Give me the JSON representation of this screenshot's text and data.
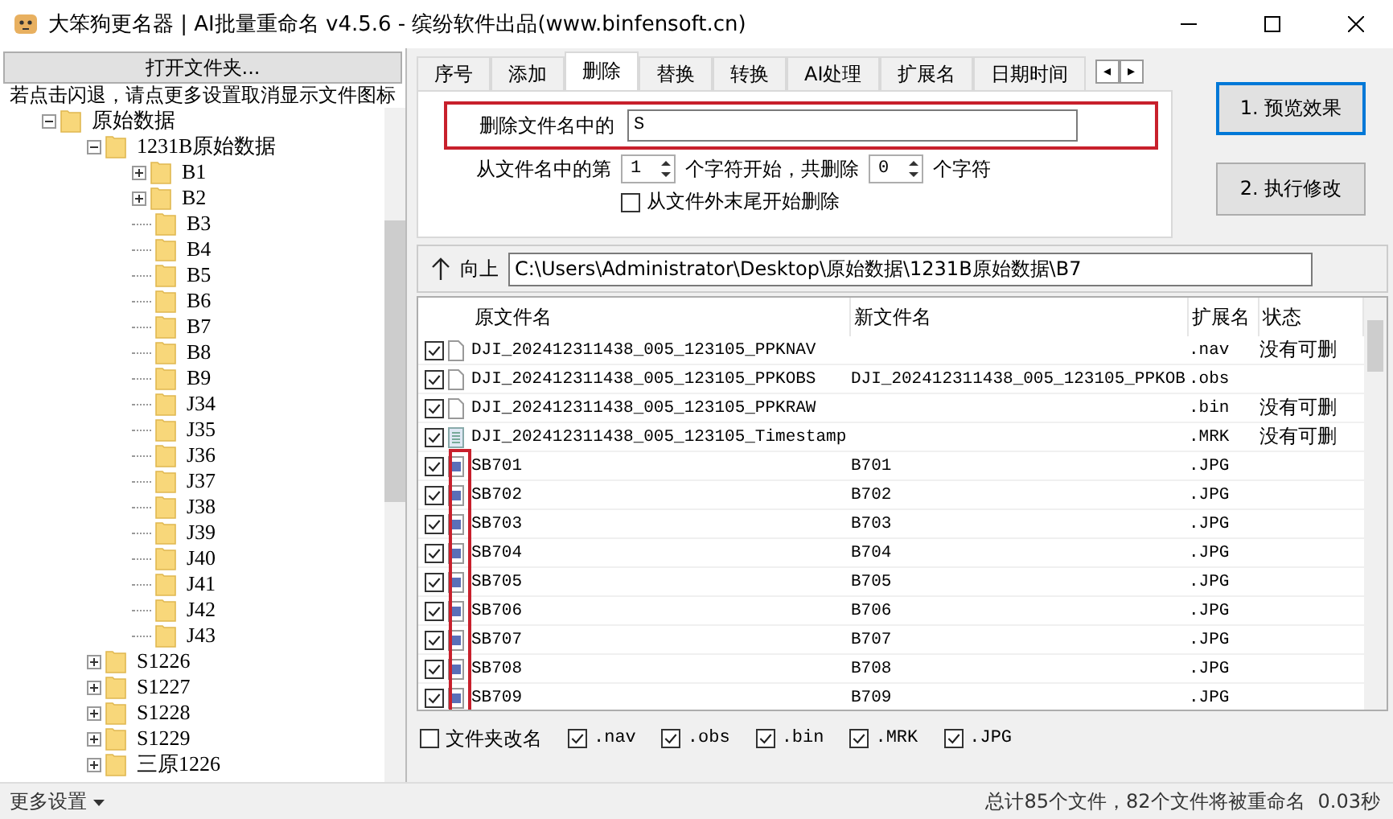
{
  "window": {
    "title": "大笨狗更名器 | AI批量重命名 v4.5.6 - 缤纷软件出品(www.binfensoft.cn)"
  },
  "sidebar": {
    "open_button": "打开文件夹...",
    "hint": "若点击闪退，请点更多设置取消显示文件图标",
    "tree": [
      {
        "label": "原始数据",
        "expanded": true,
        "children": [
          {
            "label": "1231B原始数据",
            "expanded": true,
            "children": [
              {
                "label": "B1",
                "expanded": false
              },
              {
                "label": "B2",
                "expanded": false
              },
              {
                "label": "B3"
              },
              {
                "label": "B4"
              },
              {
                "label": "B5"
              },
              {
                "label": "B6"
              },
              {
                "label": "B7"
              },
              {
                "label": "B8"
              },
              {
                "label": "B9"
              },
              {
                "label": "J34"
              },
              {
                "label": "J35"
              },
              {
                "label": "J36"
              },
              {
                "label": "J37"
              },
              {
                "label": "J38"
              },
              {
                "label": "J39"
              },
              {
                "label": "J40"
              },
              {
                "label": "J41"
              },
              {
                "label": "J42"
              },
              {
                "label": "J43"
              }
            ]
          },
          {
            "label": "S1226",
            "expanded": false
          },
          {
            "label": "S1227",
            "expanded": false
          },
          {
            "label": "S1228",
            "expanded": false
          },
          {
            "label": "S1229",
            "expanded": false
          },
          {
            "label": "三原1226",
            "expanded": false
          }
        ]
      }
    ]
  },
  "tabs": [
    {
      "label": "序号",
      "selected": false
    },
    {
      "label": "添加",
      "selected": false
    },
    {
      "label": "删除",
      "selected": true
    },
    {
      "label": "替换",
      "selected": false
    },
    {
      "label": "转换",
      "selected": false
    },
    {
      "label": "AI处理",
      "selected": false
    },
    {
      "label": "扩展名",
      "selected": false
    },
    {
      "label": "日期时间",
      "selected": false
    }
  ],
  "tab_scroll": [
    "◂",
    "▸"
  ],
  "delete_panel": {
    "text_label": "删除文件名中的",
    "text_value": "S",
    "from_label": "从文件名中的第",
    "start_value": "1",
    "mid_label": "个字符开始，共删除",
    "count_value": "0",
    "end_label": "个字符",
    "from_end": {
      "label": "从文件外末尾开始删除",
      "checked": false
    }
  },
  "actions": [
    "1. 预览效果",
    "2. 执行修改"
  ],
  "path_bar": {
    "up_label": "向上",
    "path": "C:\\Users\\Administrator\\Desktop\\原始数据\\1231B原始数据\\B7"
  },
  "table": {
    "columns": [
      "原文件名",
      "新文件名",
      "扩展名",
      "状态"
    ],
    "rows": [
      {
        "checked": true,
        "kind": "file",
        "original": "DJI_202412311438_005_123105_PPKNAV",
        "new": "",
        "ext": ".nav",
        "status": "没有可删"
      },
      {
        "checked": true,
        "kind": "file",
        "original": "DJI_202412311438_005_123105_PPKOBS",
        "new": "DJI_202412311438_005_123105_PPKOB",
        "ext": ".obs",
        "status": ""
      },
      {
        "checked": true,
        "kind": "file",
        "original": "DJI_202412311438_005_123105_PPKRAW",
        "new": "",
        "ext": ".bin",
        "status": "没有可删"
      },
      {
        "checked": true,
        "kind": "text",
        "original": "DJI_202412311438_005_123105_Timestamp",
        "new": "",
        "ext": ".MRK",
        "status": "没有可删"
      },
      {
        "checked": true,
        "kind": "image",
        "original": "SB701",
        "new": "B701",
        "ext": ".JPG",
        "status": ""
      },
      {
        "checked": true,
        "kind": "image",
        "original": "SB702",
        "new": "B702",
        "ext": ".JPG",
        "status": ""
      },
      {
        "checked": true,
        "kind": "image",
        "original": "SB703",
        "new": "B703",
        "ext": ".JPG",
        "status": ""
      },
      {
        "checked": true,
        "kind": "image",
        "original": "SB704",
        "new": "B704",
        "ext": ".JPG",
        "status": ""
      },
      {
        "checked": true,
        "kind": "image",
        "original": "SB705",
        "new": "B705",
        "ext": ".JPG",
        "status": ""
      },
      {
        "checked": true,
        "kind": "image",
        "original": "SB706",
        "new": "B706",
        "ext": ".JPG",
        "status": ""
      },
      {
        "checked": true,
        "kind": "image",
        "original": "SB707",
        "new": "B707",
        "ext": ".JPG",
        "status": ""
      },
      {
        "checked": true,
        "kind": "image",
        "original": "SB708",
        "new": "B708",
        "ext": ".JPG",
        "status": ""
      },
      {
        "checked": true,
        "kind": "image",
        "original": "SB709",
        "new": "B709",
        "ext": ".JPG",
        "status": ""
      }
    ]
  },
  "filters": [
    {
      "label": "文件夹改名",
      "checked": false
    },
    {
      "label": ".nav",
      "checked": true
    },
    {
      "label": ".obs",
      "checked": true
    },
    {
      "label": ".bin",
      "checked": true
    },
    {
      "label": ".MRK",
      "checked": true
    },
    {
      "label": ".JPG",
      "checked": true
    }
  ],
  "status_bar": {
    "menu": "更多设置",
    "summary": "总计85个文件，82个文件将被重命名",
    "time": "0.03秒"
  }
}
